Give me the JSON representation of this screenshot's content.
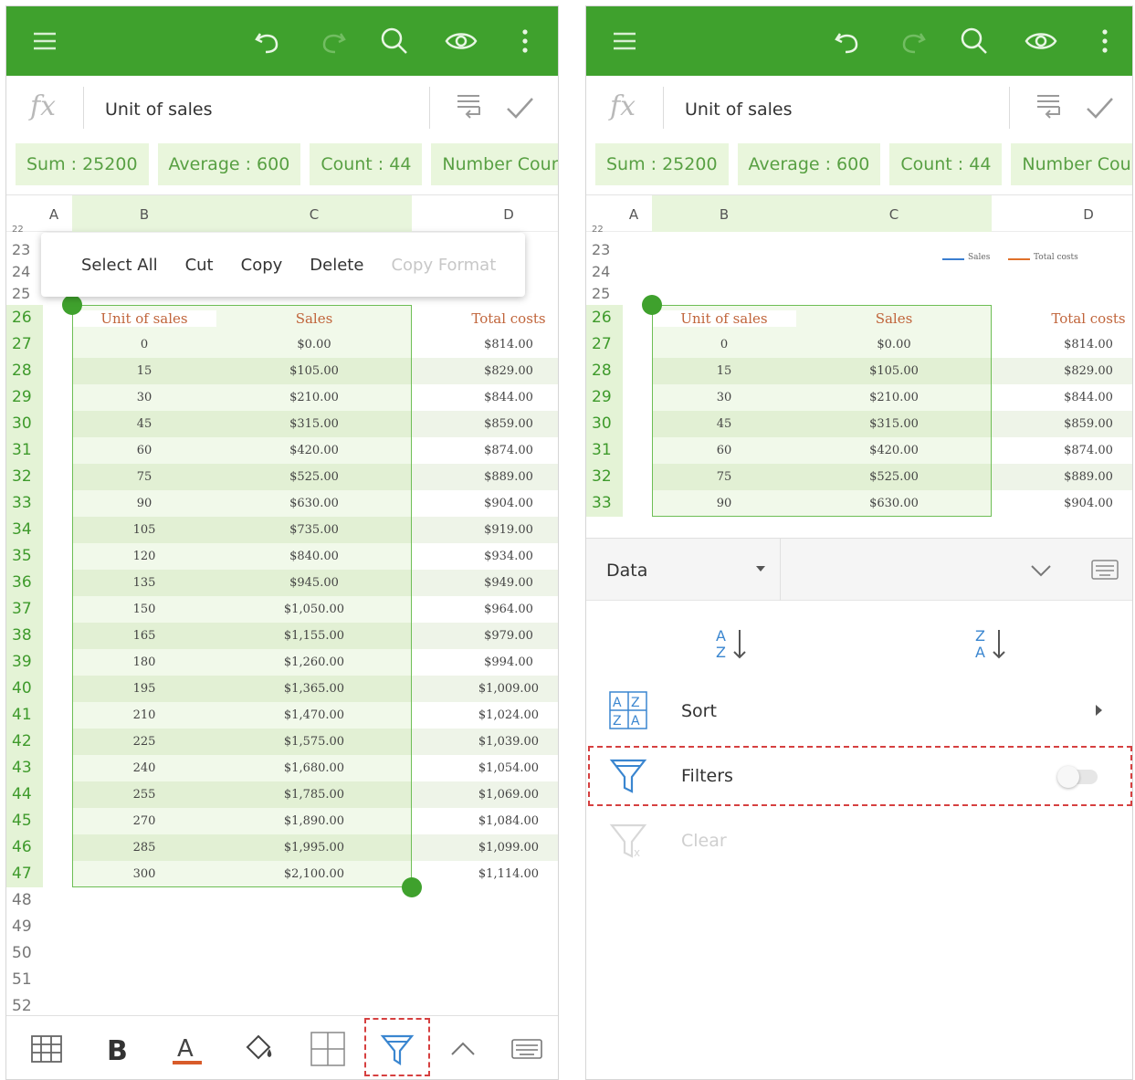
{
  "formula_bar": {
    "fx_label": "fx",
    "cell_text": "Unit of sales"
  },
  "stats": [
    "Sum : 25200",
    "Average : 600",
    "Count : 44",
    "Number Count"
  ],
  "columns": [
    "A",
    "B",
    "C",
    "D"
  ],
  "context_menu": {
    "items": [
      "Select All",
      "Cut",
      "Copy",
      "Delete",
      "Copy Format"
    ]
  },
  "table": {
    "headers": [
      "Unit of sales",
      "Sales",
      "Total costs"
    ],
    "top_rows": [
      "22",
      "23",
      "24",
      "25"
    ],
    "rows": [
      [
        "26",
        "",
        "",
        ""
      ],
      [
        "27",
        "0",
        "$0.00",
        "$814.00"
      ],
      [
        "28",
        "15",
        "$105.00",
        "$829.00"
      ],
      [
        "29",
        "30",
        "$210.00",
        "$844.00"
      ],
      [
        "30",
        "45",
        "$315.00",
        "$859.00"
      ],
      [
        "31",
        "60",
        "$420.00",
        "$874.00"
      ],
      [
        "32",
        "75",
        "$525.00",
        "$889.00"
      ],
      [
        "33",
        "90",
        "$630.00",
        "$904.00"
      ],
      [
        "34",
        "105",
        "$735.00",
        "$919.00"
      ],
      [
        "35",
        "120",
        "$840.00",
        "$934.00"
      ],
      [
        "36",
        "135",
        "$945.00",
        "$949.00"
      ],
      [
        "37",
        "150",
        "$1,050.00",
        "$964.00"
      ],
      [
        "38",
        "165",
        "$1,155.00",
        "$979.00"
      ],
      [
        "39",
        "180",
        "$1,260.00",
        "$994.00"
      ],
      [
        "40",
        "195",
        "$1,365.00",
        "$1,009.00"
      ],
      [
        "41",
        "210",
        "$1,470.00",
        "$1,024.00"
      ],
      [
        "42",
        "225",
        "$1,575.00",
        "$1,039.00"
      ],
      [
        "43",
        "240",
        "$1,680.00",
        "$1,054.00"
      ],
      [
        "44",
        "255",
        "$1,785.00",
        "$1,069.00"
      ],
      [
        "45",
        "270",
        "$1,890.00",
        "$1,084.00"
      ],
      [
        "46",
        "285",
        "$1,995.00",
        "$1,099.00"
      ],
      [
        "47",
        "300",
        "$2,100.00",
        "$1,114.00"
      ]
    ],
    "empty_rows": [
      "48",
      "49",
      "50",
      "51",
      "52"
    ]
  },
  "chart_legend": {
    "series1": "Sales",
    "series2": "Total costs"
  },
  "data_sheet": {
    "dropdown_label": "Data",
    "sort_label": "Sort",
    "filters_label": "Filters",
    "clear_label": "Clear",
    "filters_enabled": false
  },
  "colors": {
    "appbar": "#3fa12d",
    "accent": "#3fa12d",
    "selection": "#e8f5dc",
    "header_text": "#c0643a",
    "dash": "#d64040"
  },
  "icons": {
    "appbar": [
      "menu-icon",
      "undo-icon",
      "redo-icon",
      "search-icon",
      "eye-icon",
      "more-vertical-icon"
    ],
    "bottom_toolbar": [
      "table-icon",
      "bold-icon",
      "font-color-icon",
      "fill-color-icon",
      "borders-icon",
      "filter-icon",
      "chevron-up-icon",
      "keyboard-icon"
    ]
  }
}
